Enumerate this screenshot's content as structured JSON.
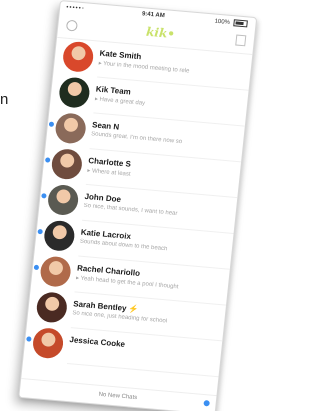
{
  "edge_text": "n",
  "status_bar": {
    "carrier": "•••••◦",
    "time": "9:41 AM",
    "battery": "100%"
  },
  "nav": {
    "logo": "kik•"
  },
  "colors": {
    "unread": "#3b8ff2",
    "logo": "#c9e26a",
    "preview": "#a7a7a7"
  },
  "chats": [
    {
      "name": "Kate Smith",
      "preview": "▸ Your in the mood meeting to rele",
      "unread": false,
      "avatar_color": "#d9482b"
    },
    {
      "name": "Kik Team",
      "preview": "▸ Have a great day",
      "unread": false,
      "avatar_color": "#1f2d1f"
    },
    {
      "name": "Sean N",
      "preview": "Sounds great. I'm on there now so",
      "unread": true,
      "avatar_color": "#8a6a5a"
    },
    {
      "name": "Charlotte S",
      "preview": "▸ Where at least",
      "unread": true,
      "avatar_color": "#6f4c3e"
    },
    {
      "name": "John Doe",
      "preview": "So nice, that sounds, I want to hear",
      "unread": true,
      "avatar_color": "#5a5a52"
    },
    {
      "name": "Katie Lacroix",
      "preview": "Sounds about down to the beach",
      "unread": true,
      "avatar_color": "#2a2a2a"
    },
    {
      "name": "Rachel Chariollo",
      "preview": "▸ Yeah head to get the a pool I thought",
      "unread": true,
      "avatar_color": "#b06a4a"
    },
    {
      "name": "Sarah Bentley ⚡",
      "preview": "So nice one, just heading for school",
      "unread": false,
      "avatar_color": "#4a2a22"
    },
    {
      "name": "Jessica Cooke",
      "preview": "",
      "unread": true,
      "avatar_color": "#c54a2a"
    }
  ],
  "footer": {
    "label": "No New Chats"
  }
}
